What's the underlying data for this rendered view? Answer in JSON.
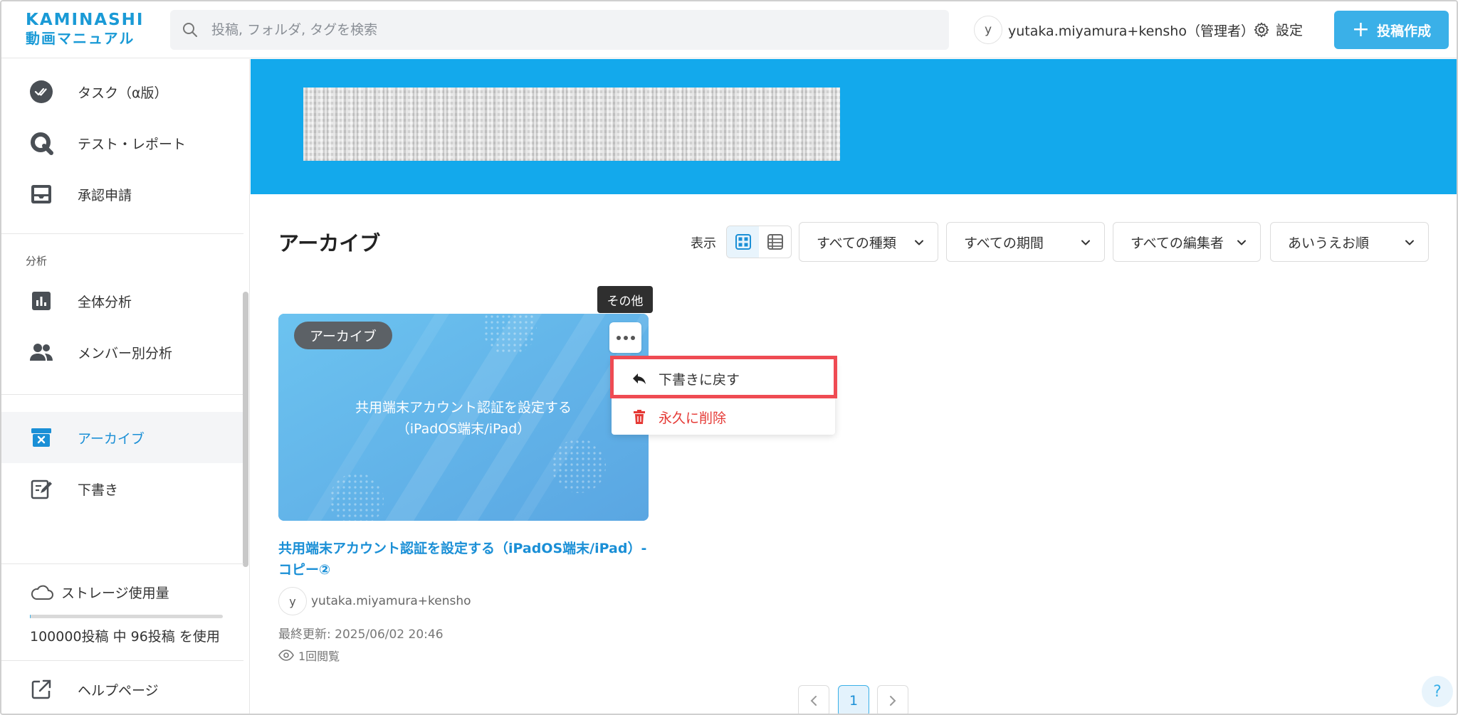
{
  "header": {
    "logo_top": "KAMINASHI",
    "logo_bottom": "動画マニュアル",
    "search_placeholder": "投稿, フォルダ, タグを検索",
    "user_initial": "y",
    "user_name": "yutaka.miyamura+kensho（管理者）",
    "settings_label": "設定",
    "create_label": "投稿作成"
  },
  "sidebar": {
    "items_top": [
      {
        "label": "タスク（α版）",
        "icon": "double-check-icon"
      },
      {
        "label": "テスト・レポート",
        "icon": "q-icon"
      },
      {
        "label": "承認申請",
        "icon": "inbox-icon"
      }
    ],
    "analysis_heading": "分析",
    "analysis_items": [
      {
        "label": "全体分析",
        "icon": "bar-chart-icon"
      },
      {
        "label": "メンバー別分析",
        "icon": "people-icon"
      }
    ],
    "items_bottom": [
      {
        "label": "アーカイブ",
        "icon": "archive-icon",
        "active": true
      },
      {
        "label": "下書き",
        "icon": "edit-icon"
      }
    ],
    "storage_label": "ストレージ使用量",
    "storage_fraction": 0.00096,
    "storage_text": "100000投稿 中 96投稿 を使用",
    "help_label": "ヘルプページ"
  },
  "main": {
    "title": "アーカイブ",
    "view_label": "表示",
    "filters": [
      "すべての種類",
      "すべての期間",
      "すべての編集者",
      "あいうえお順"
    ],
    "card": {
      "badge": "アーカイブ",
      "thumb_line1": "共用端末アカウント認証を設定する",
      "thumb_line2": "（iPadOS端末/iPad）",
      "tooltip": "その他",
      "title": "共用端末アカウント認証を設定する（iPadOS端末/iPad）- コピー②",
      "author_initial": "y",
      "author": "yutaka.miyamura+kensho",
      "updated": "最終更新: 2025/06/02 20:46",
      "views": "1回閲覧"
    },
    "menu": {
      "restore": "下書きに戻す",
      "delete": "永久に削除"
    },
    "pagination": {
      "current": "1"
    },
    "help": "?"
  },
  "colors": {
    "accent": "#3ab0e8",
    "banner": "#13a9ec",
    "danger": "#e53935",
    "highlight": "#ef4b53"
  }
}
